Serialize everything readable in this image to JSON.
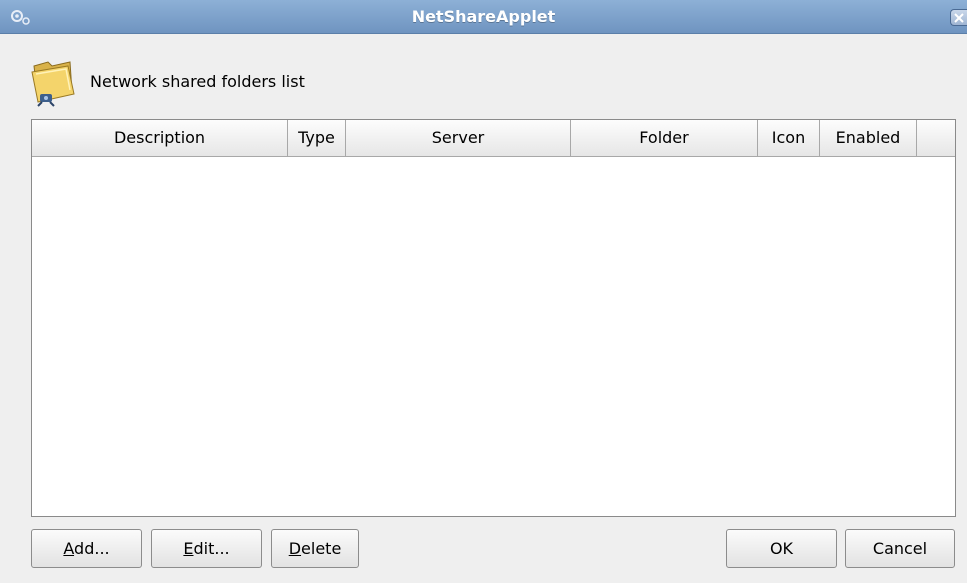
{
  "window": {
    "title": "NetShareApplet"
  },
  "header": {
    "label": "Network shared folders list",
    "icon": "network-folder-icon"
  },
  "table": {
    "columns": [
      "Description",
      "Type",
      "Server",
      "Folder",
      "Icon",
      "Enabled"
    ],
    "rows": []
  },
  "buttons": {
    "add": {
      "mnemonic": "A",
      "rest": "dd..."
    },
    "edit": {
      "mnemonic": "E",
      "rest": "dit..."
    },
    "delete": {
      "mnemonic": "D",
      "rest": "elete"
    },
    "ok": "OK",
    "cancel": "Cancel"
  },
  "colors": {
    "titlebar": "#7ba1cc",
    "title_text": "#ffffff",
    "window_bg": "#efefef",
    "list_bg": "#ffffff"
  }
}
